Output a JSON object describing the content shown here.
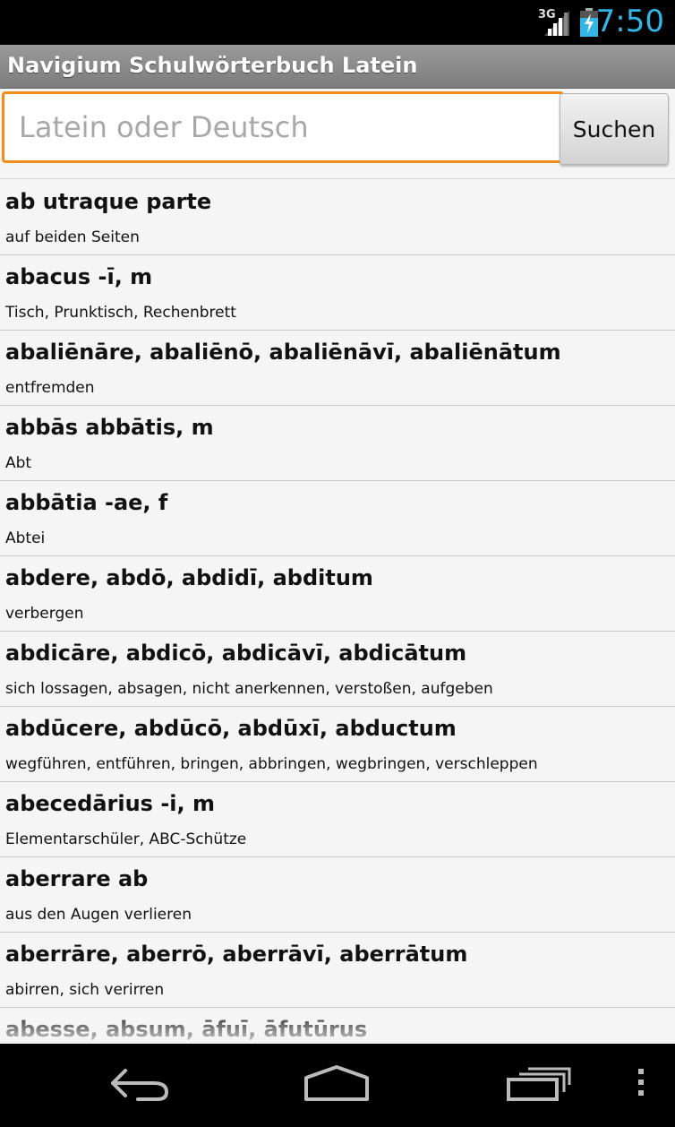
{
  "status_bar": {
    "network": "3G",
    "time": "7:50",
    "accent_color": "#33b5e5"
  },
  "app": {
    "title": "Navigium Schulwörterbuch Latein"
  },
  "search": {
    "placeholder": "Latein oder Deutsch",
    "value": "",
    "button_label": "Suchen",
    "focus_color": "#f08c1a"
  },
  "entries": [
    {
      "term": "ab utraque parte",
      "translation": "auf beiden Seiten"
    },
    {
      "term": "abacus -ī, m",
      "translation": "Tisch, Prunktisch, Rechenbrett"
    },
    {
      "term": "abaliēnāre, abaliēnō, abaliēnāvī, abaliēnātum",
      "translation": "entfremden"
    },
    {
      "term": "abbās abbātis, m",
      "translation": "Abt"
    },
    {
      "term": "abbātia -ae, f",
      "translation": "Abtei"
    },
    {
      "term": "abdere, abdō, abdidī, abditum",
      "translation": "verbergen"
    },
    {
      "term": "abdicāre, abdicō, abdicāvī, abdicātum",
      "translation": "sich lossagen, absagen, nicht anerkennen, verstoßen, aufgeben"
    },
    {
      "term": "abdūcere, abdūcō, abdūxī, abductum",
      "translation": "wegführen, entführen, bringen, abbringen, wegbringen, verschleppen"
    },
    {
      "term": "abecedārius -i, m",
      "translation": "Elementarschüler, ABC-Schütze"
    },
    {
      "term": "aberrare ab",
      "translation": " aus den Augen verlieren"
    },
    {
      "term": "aberrāre, aberrō, aberrāvī, aberrātum",
      "translation": "abirren, sich verirren"
    },
    {
      "term": "abesse, absum, āfuī, āfutūrus",
      "translation": ""
    }
  ],
  "nav_bar": {
    "icons": [
      "back-icon",
      "home-icon",
      "recent-apps-icon",
      "menu-icon"
    ]
  }
}
